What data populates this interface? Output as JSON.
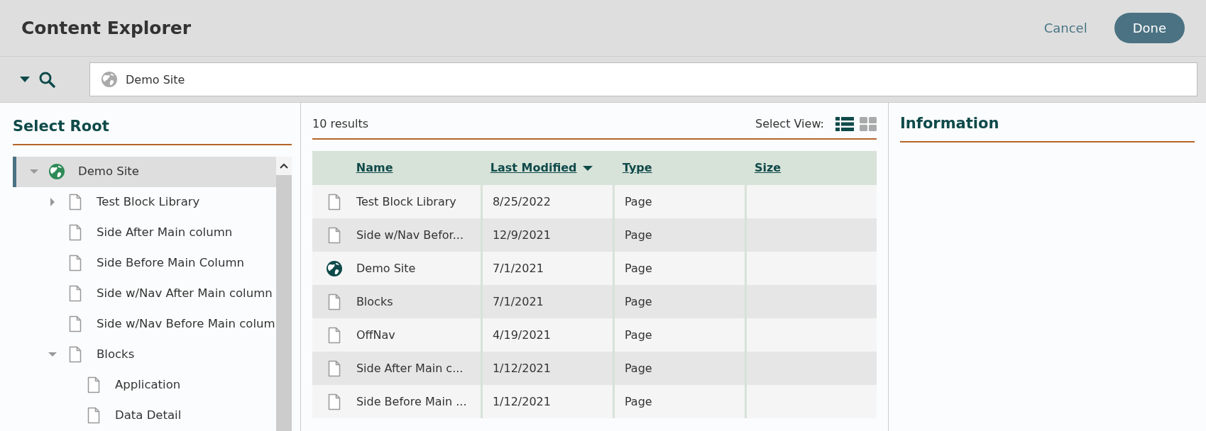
{
  "window": {
    "title": "Content Explorer",
    "actions": [
      {
        "kind": "link",
        "label": "Cancel"
      },
      {
        "kind": "primary",
        "label": "Done"
      }
    ]
  },
  "search": {
    "value": "Demo Site"
  },
  "tree": {
    "title": "Select Root",
    "items": [
      {
        "label": "Demo Site",
        "kind": "globe",
        "selected": true,
        "expanded": true,
        "children": [
          {
            "label": "Test Block Library",
            "kind": "page",
            "selected": false,
            "expanded": false
          },
          {
            "label": "Side After Main column",
            "kind": "page",
            "selected": false
          },
          {
            "label": "Side Before Main Column",
            "kind": "page",
            "selected": false
          },
          {
            "label": "Side w/Nav After Main column",
            "kind": "page",
            "selected": false
          },
          {
            "label": "Side w/Nav Before Main colum",
            "kind": "page",
            "selected": false
          },
          {
            "label": "Blocks",
            "kind": "page",
            "selected": false,
            "expanded": true,
            "children": [
              {
                "label": "Application",
                "kind": "page",
                "selected": false
              },
              {
                "label": "Data Detail",
                "kind": "page",
                "selected": false
              }
            ]
          }
        ]
      }
    ]
  },
  "results": {
    "count": "10 results",
    "view_label": "Select View:",
    "views": [
      {
        "kind": "list",
        "selected": true
      },
      {
        "kind": "grid",
        "selected": false
      }
    ],
    "columns": [
      {
        "label": "Name",
        "sorted": false
      },
      {
        "label": "Last Modified",
        "sorted": true
      },
      {
        "label": "Type",
        "sorted": false
      },
      {
        "label": "Size",
        "sorted": false
      }
    ],
    "rows": [
      {
        "kind": "page",
        "name": "Test Block Library",
        "modified": "8/25/2022",
        "type": "Page"
      },
      {
        "kind": "page",
        "name": "Side w/Nav Befor...",
        "modified": "12/9/2021",
        "type": "Page"
      },
      {
        "kind": "globe",
        "name": "Demo Site",
        "modified": "7/1/2021",
        "type": "Page"
      },
      {
        "kind": "page",
        "name": "Blocks",
        "modified": "7/1/2021",
        "type": "Page"
      },
      {
        "kind": "page",
        "name": "OffNav",
        "modified": "4/19/2021",
        "type": "Page"
      },
      {
        "kind": "page",
        "name": "Side After Main c...",
        "modified": "1/12/2021",
        "type": "Page"
      },
      {
        "kind": "page",
        "name": "Side Before Main ...",
        "modified": "1/12/2021",
        "type": "Page"
      }
    ]
  },
  "information": {
    "title": "Information"
  }
}
